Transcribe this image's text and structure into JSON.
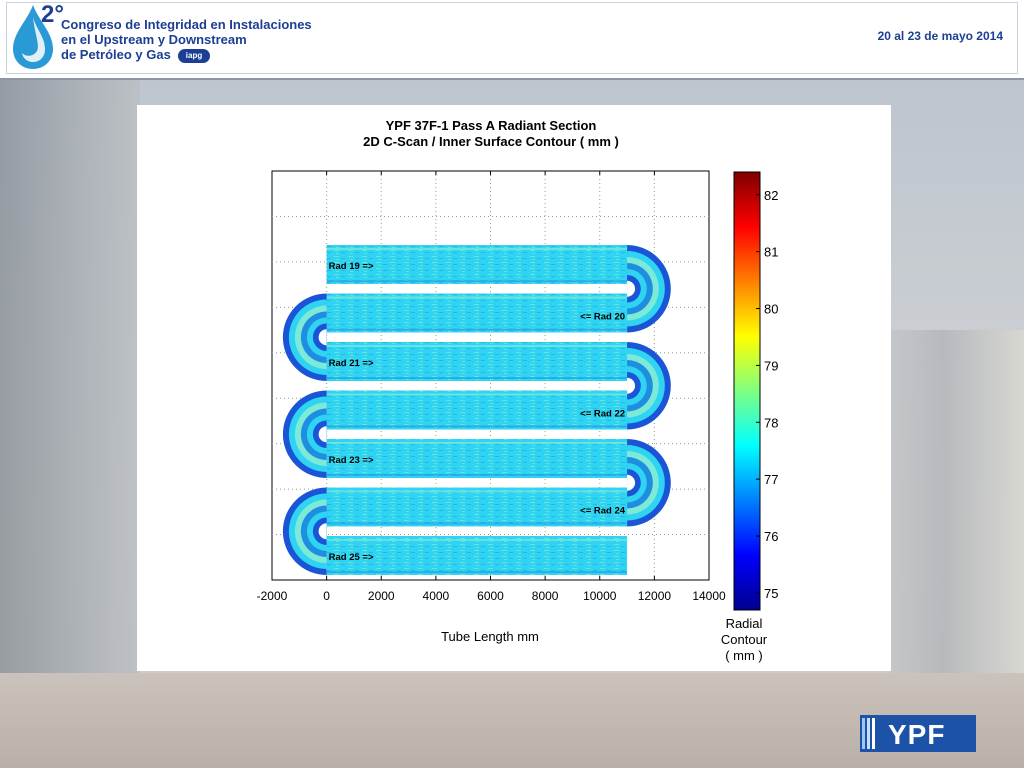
{
  "header": {
    "congress_lines": [
      "Congreso de Integridad en Instalaciones",
      "en el Upstream y Downstream",
      "de Petróleo y Gas"
    ],
    "edition": "2°",
    "iapg": "iapg",
    "dates": "20 al 23 de mayo 2014"
  },
  "logo": {
    "text": "YPF"
  },
  "chart_data": {
    "type": "heatmap",
    "title": "YPF 37F-1 Pass A Radiant Section",
    "subtitle": "2D C-Scan / Inner Surface Contour ( mm )",
    "xlabel": "Tube Length mm",
    "xlim": [
      -2000,
      14000
    ],
    "x_ticks": [
      "-2000",
      "0",
      "2000",
      "4000",
      "6000",
      "8000",
      "10000",
      "12000",
      "14000"
    ],
    "grid": true,
    "colorbar": {
      "ticks": [
        "82",
        "81",
        "80",
        "79",
        "78",
        "77",
        "76",
        "75"
      ],
      "label": [
        "Radial",
        "Contour",
        "( mm )"
      ],
      "range": [
        74.7,
        82.4
      ],
      "colors": [
        "#00008f",
        "#0000ff",
        "#0080ff",
        "#00ffff",
        "#80ff80",
        "#ffff00",
        "#ff8000",
        "#ff0000",
        "#800000"
      ]
    },
    "tubes": [
      {
        "label": "Rad 19 =>",
        "direction": "right",
        "bend": "right"
      },
      {
        "label": "<= Rad 20",
        "direction": "left",
        "bend": "left"
      },
      {
        "label": "Rad 21 =>",
        "direction": "right",
        "bend": "right"
      },
      {
        "label": "<= Rad 22",
        "direction": "left",
        "bend": "left"
      },
      {
        "label": "Rad 23 =>",
        "direction": "right",
        "bend": "right"
      },
      {
        "label": "<= Rad 24",
        "direction": "left",
        "bend": "left"
      },
      {
        "label": "Rad 25 =>",
        "direction": "right",
        "bend": "none"
      }
    ],
    "tube_colors": {
      "base": "#2fd4f2",
      "light": "#7dead8",
      "dark": "#1f8ee0",
      "edge": "#1a55d8"
    }
  }
}
